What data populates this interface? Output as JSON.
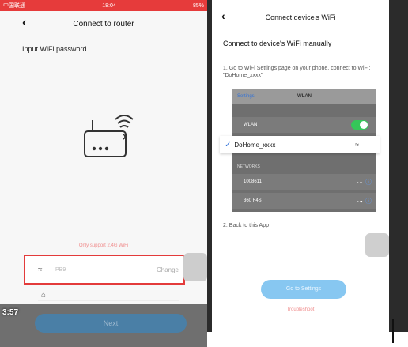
{
  "left": {
    "statusbar": {
      "carrier": "中国联通",
      "time": "18:04",
      "battery": "85%"
    },
    "title": "Connect to router",
    "prompt": "Input WiFi password",
    "support_note": "Only support 2.4G WiFi",
    "ssid": "PB9",
    "change_label": "Change",
    "next_label": "Next",
    "video_time": "3:57"
  },
  "right": {
    "title": "Connect device's WiFi",
    "heading": "Connect to device's WiFi manually",
    "step1": "1. Go to WiFi Settings page on your phone, connect to WiFi: \"DoHome_xxxx\"",
    "step2": "2. Back to this App",
    "settings_mock": {
      "back": "Settings",
      "title": "WLAN",
      "wlan": "WLAN",
      "selected_ssid": "DoHome_xxxx",
      "networks_label": "NETWORKS",
      "networks": [
        "1008611",
        "360 F4S"
      ]
    },
    "go_label": "Go to Settings",
    "troubleshoot": "Troubleshoot"
  },
  "colors": {
    "status_red": "#e63b3b",
    "highlight_border": "#e33b3b",
    "toggle_green": "#35c759",
    "button_blue": "#87c7f1",
    "note_pink": "#f08c8c"
  }
}
